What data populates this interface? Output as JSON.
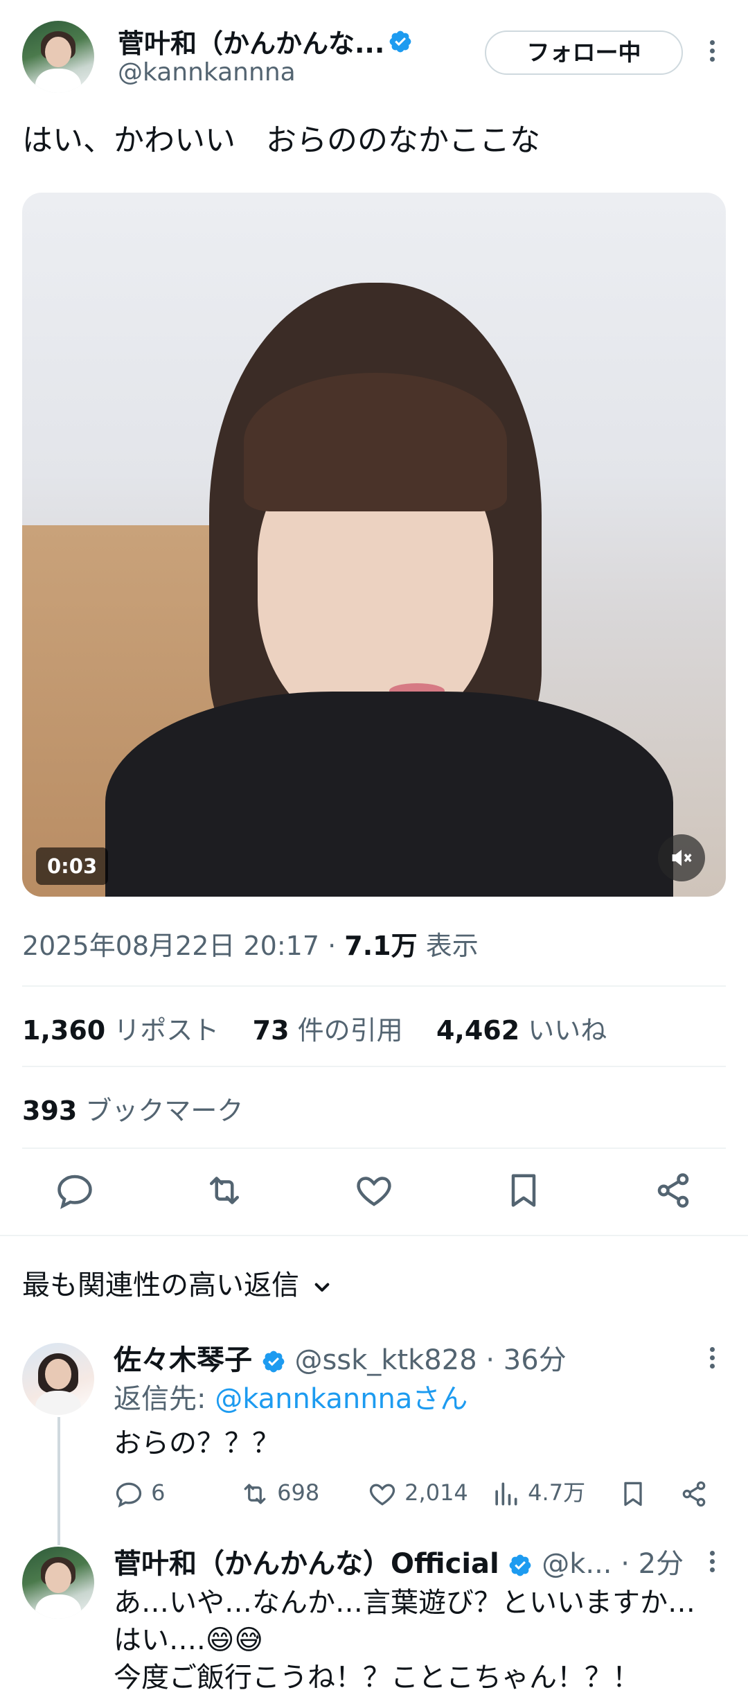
{
  "tweet": {
    "author_name": "菅叶和（かんかんな...",
    "handle": "@kannkannna",
    "follow_label": "フォロー中",
    "text": "はい、かわいい　おらののなかここな",
    "video_time": "0:03",
    "timestamp": "2025年08月22日 20:17",
    "separator": "·",
    "views_count": "7.1万",
    "views_label": "表示"
  },
  "stats": {
    "reposts_count": "1,360",
    "reposts_label": "リポスト",
    "quotes_count": "73",
    "quotes_label": "件の引用",
    "likes_count": "4,462",
    "likes_label": "いいね",
    "bookmarks_count": "393",
    "bookmarks_label": "ブックマーク"
  },
  "actions": [
    "reply-icon",
    "retweet-icon",
    "heart-icon",
    "bookmark-icon",
    "share-icon"
  ],
  "replies_sort_label": "最も関連性の高い返信",
  "replies": [
    {
      "name": "佐々木琴子",
      "handle": "@ssk_ktk828",
      "time": "· 36分",
      "reply_to_prefix": "返信先: ",
      "reply_to_handle": "@kannkannna",
      "reply_to_suffix": "さん",
      "text": "おらの？？？",
      "reply_count": "6",
      "retweet_count": "698",
      "like_count": "2,014",
      "view_count": "4.7万"
    },
    {
      "name": "菅叶和（かんかんな）Official",
      "handle": "@k...",
      "time": "· 2分",
      "text_line1": "あ…いや…なんか…言葉遊び？といいますか…",
      "text_line2": "はい….😄😅",
      "text_line3": "今度ご飯行こうね！？ことこちゃん！？！"
    }
  ],
  "colors": {
    "accent": "#1d9bf0",
    "text": "#0f1419",
    "muted": "#536471",
    "divider": "#eff3f4"
  }
}
